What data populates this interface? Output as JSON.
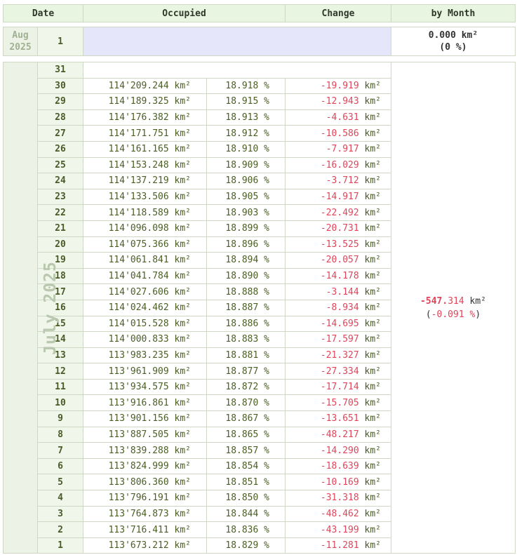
{
  "header": {
    "date": "Date",
    "occupied": "Occupied",
    "change": "Change",
    "by_month": "by Month"
  },
  "aug": {
    "month_line1": "Aug",
    "month_line2": "2025",
    "day": "1",
    "month_value": "0.000",
    "month_unit": "km²",
    "month_pct_open": "(",
    "month_pct": "0 %",
    "month_pct_close": ")"
  },
  "july": {
    "label": "July 2025",
    "month_value_int": "-547.",
    "month_value_dec": "314",
    "month_unit": "km²",
    "month_pct_open": "(",
    "month_pct": "-0.091 %",
    "month_pct_close": ")",
    "empty_day": "31",
    "rows": [
      {
        "day": "30",
        "occupied": "114'209.244",
        "unit": "km²",
        "pct": "18.918",
        "pct_sign": "%",
        "change": "-19.919",
        "change_unit": "km²"
      },
      {
        "day": "29",
        "occupied": "114'189.325",
        "unit": "km²",
        "pct": "18.915",
        "pct_sign": "%",
        "change": "-12.943",
        "change_unit": "km²"
      },
      {
        "day": "28",
        "occupied": "114'176.382",
        "unit": "km²",
        "pct": "18.913",
        "pct_sign": "%",
        "change": "-4.631",
        "change_unit": "km²"
      },
      {
        "day": "27",
        "occupied": "114'171.751",
        "unit": "km²",
        "pct": "18.912",
        "pct_sign": "%",
        "change": "-10.586",
        "change_unit": "km²"
      },
      {
        "day": "26",
        "occupied": "114'161.165",
        "unit": "km²",
        "pct": "18.910",
        "pct_sign": "%",
        "change": "-7.917",
        "change_unit": "km²"
      },
      {
        "day": "25",
        "occupied": "114'153.248",
        "unit": "km²",
        "pct": "18.909",
        "pct_sign": "%",
        "change": "-16.029",
        "change_unit": "km²"
      },
      {
        "day": "24",
        "occupied": "114'137.219",
        "unit": "km²",
        "pct": "18.906",
        "pct_sign": "%",
        "change": "-3.712",
        "change_unit": "km²"
      },
      {
        "day": "23",
        "occupied": "114'133.506",
        "unit": "km²",
        "pct": "18.905",
        "pct_sign": "%",
        "change": "-14.917",
        "change_unit": "km²"
      },
      {
        "day": "22",
        "occupied": "114'118.589",
        "unit": "km²",
        "pct": "18.903",
        "pct_sign": "%",
        "change": "-22.492",
        "change_unit": "km²"
      },
      {
        "day": "21",
        "occupied": "114'096.098",
        "unit": "km²",
        "pct": "18.899",
        "pct_sign": "%",
        "change": "-20.731",
        "change_unit": "km²"
      },
      {
        "day": "20",
        "occupied": "114'075.366",
        "unit": "km²",
        "pct": "18.896",
        "pct_sign": "%",
        "change": "-13.525",
        "change_unit": "km²"
      },
      {
        "day": "19",
        "occupied": "114'061.841",
        "unit": "km²",
        "pct": "18.894",
        "pct_sign": "%",
        "change": "-20.057",
        "change_unit": "km²"
      },
      {
        "day": "18",
        "occupied": "114'041.784",
        "unit": "km²",
        "pct": "18.890",
        "pct_sign": "%",
        "change": "-14.178",
        "change_unit": "km²"
      },
      {
        "day": "17",
        "occupied": "114'027.606",
        "unit": "km²",
        "pct": "18.888",
        "pct_sign": "%",
        "change": "-3.144",
        "change_unit": "km²"
      },
      {
        "day": "16",
        "occupied": "114'024.462",
        "unit": "km²",
        "pct": "18.887",
        "pct_sign": "%",
        "change": "-8.934",
        "change_unit": "km²"
      },
      {
        "day": "15",
        "occupied": "114'015.528",
        "unit": "km²",
        "pct": "18.886",
        "pct_sign": "%",
        "change": "-14.695",
        "change_unit": "km²"
      },
      {
        "day": "14",
        "occupied": "114'000.833",
        "unit": "km²",
        "pct": "18.883",
        "pct_sign": "%",
        "change": "-17.597",
        "change_unit": "km²"
      },
      {
        "day": "13",
        "occupied": "113'983.235",
        "unit": "km²",
        "pct": "18.881",
        "pct_sign": "%",
        "change": "-21.327",
        "change_unit": "km²"
      },
      {
        "day": "12",
        "occupied": "113'961.909",
        "unit": "km²",
        "pct": "18.877",
        "pct_sign": "%",
        "change": "-27.334",
        "change_unit": "km²"
      },
      {
        "day": "11",
        "occupied": "113'934.575",
        "unit": "km²",
        "pct": "18.872",
        "pct_sign": "%",
        "change": "-17.714",
        "change_unit": "km²"
      },
      {
        "day": "10",
        "occupied": "113'916.861",
        "unit": "km²",
        "pct": "18.870",
        "pct_sign": "%",
        "change": "-15.705",
        "change_unit": "km²"
      },
      {
        "day": "9",
        "occupied": "113'901.156",
        "unit": "km²",
        "pct": "18.867",
        "pct_sign": "%",
        "change": "-13.651",
        "change_unit": "km²"
      },
      {
        "day": "8",
        "occupied": "113'887.505",
        "unit": "km²",
        "pct": "18.865",
        "pct_sign": "%",
        "change": "-48.217",
        "change_unit": "km²"
      },
      {
        "day": "7",
        "occupied": "113'839.288",
        "unit": "km²",
        "pct": "18.857",
        "pct_sign": "%",
        "change": "-14.290",
        "change_unit": "km²"
      },
      {
        "day": "6",
        "occupied": "113'824.999",
        "unit": "km²",
        "pct": "18.854",
        "pct_sign": "%",
        "change": "-18.639",
        "change_unit": "km²"
      },
      {
        "day": "5",
        "occupied": "113'806.360",
        "unit": "km²",
        "pct": "18.851",
        "pct_sign": "%",
        "change": "-10.169",
        "change_unit": "km²"
      },
      {
        "day": "4",
        "occupied": "113'796.191",
        "unit": "km²",
        "pct": "18.850",
        "pct_sign": "%",
        "change": "-31.318",
        "change_unit": "km²"
      },
      {
        "day": "3",
        "occupied": "113'764.873",
        "unit": "km²",
        "pct": "18.844",
        "pct_sign": "%",
        "change": "-48.462",
        "change_unit": "km²"
      },
      {
        "day": "2",
        "occupied": "113'716.411",
        "unit": "km²",
        "pct": "18.836",
        "pct_sign": "%",
        "change": "-43.199",
        "change_unit": "km²"
      },
      {
        "day": "1",
        "occupied": "113'673.212",
        "unit": "km²",
        "pct": "18.829",
        "pct_sign": "%",
        "change": "-11.281",
        "change_unit": "km²"
      }
    ]
  },
  "colors": {
    "header_bg": "#e8f5e0",
    "negative": "#e0455a",
    "value_text": "#4b5e24",
    "month_label": "#b9c8ae",
    "aug_bar": "#e6e6fa"
  }
}
